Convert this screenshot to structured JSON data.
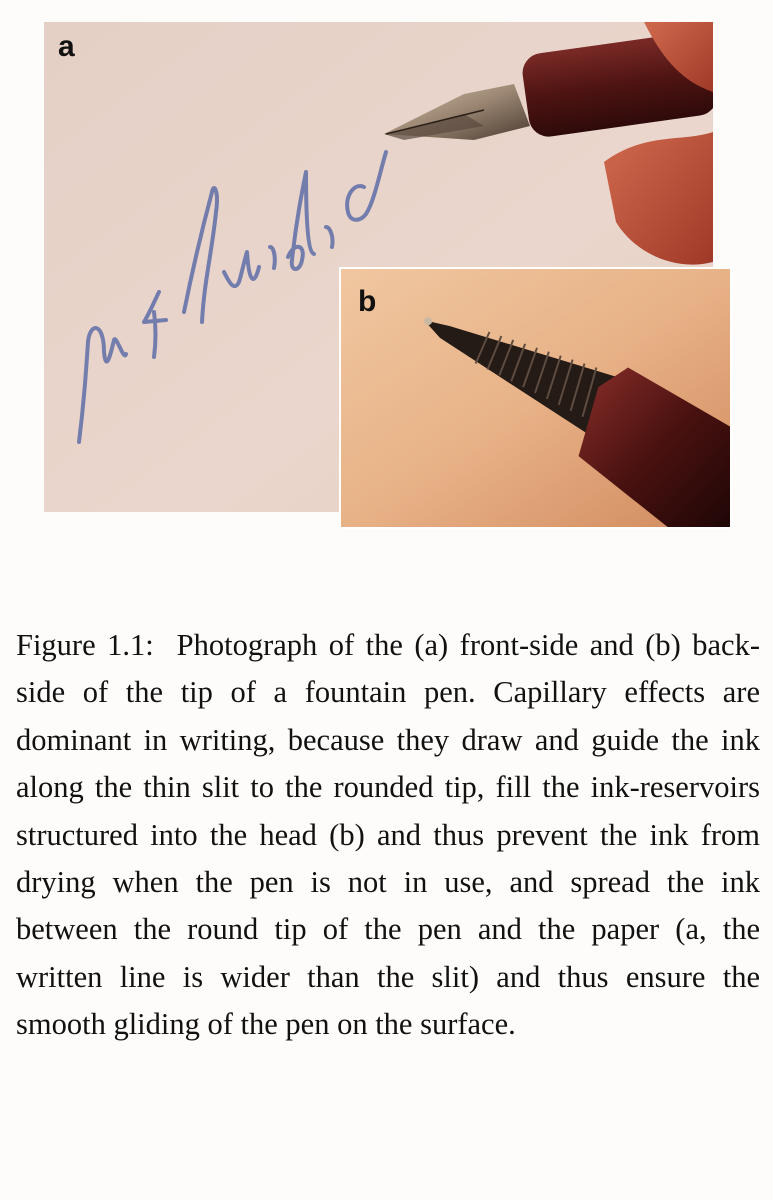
{
  "figure": {
    "panel_a": {
      "label": "a"
    },
    "panel_b": {
      "label": "b"
    },
    "caption": {
      "label": "Figure 1.1:",
      "text": "Photograph of the (a) front-side and (b) back-side of the tip of a fountain pen. Capillary effects are dominant in writing, because they draw and guide the ink along the thin slit to the rounded tip, fill the ink-reservoirs structured into the head (b) and thus prevent the ink from drying when the pen is not in use, and spread the ink between the round tip of the pen and the paper (a, the written line is wider than the slit) and thus ensure the smooth gliding of the pen on the surface."
    }
  },
  "colors": {
    "paper_a": "#e9d3c9",
    "ink": "#5f6fa8",
    "pen_body": "#5c1a18",
    "skin": "#c0513a",
    "paper_b": "#e9b58c"
  }
}
